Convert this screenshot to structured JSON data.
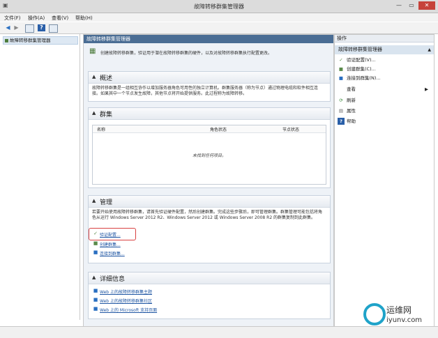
{
  "window": {
    "title": "故障转移群集管理器",
    "btn_min": "—",
    "btn_max": "▭",
    "btn_close": "✕"
  },
  "menu": [
    "文件(F)",
    "操作(A)",
    "查看(V)",
    "帮助(H)"
  ],
  "toolbar": {
    "back": "◀",
    "forward": "▶"
  },
  "tree": {
    "root": "故障转移群集管理器"
  },
  "center": {
    "header": "故障转移群集管理器",
    "intro": "创建故障转移群集，验证用于潜在故障转移群集的硬件，以及对故障转移群集执行配置更改。",
    "overview": {
      "title": "概述",
      "text": "故障转移群集是一组相互协作以增加服务器角色可用性的独立计算机。群集服务器（称为节点）通过物理电缆和软件相互连接。如果其中一个节点发生故障，其他节点将开始提供服务。此过程称为故障转移。"
    },
    "clusters": {
      "title": "群集",
      "columns": [
        "名称",
        "角色状态",
        "节点状态"
      ],
      "empty": "未找到任何项目。"
    },
    "manage": {
      "title": "管理",
      "text": "若要开始使用故障转移群集，请首先验证硬件配置，然后创建群集。完成这些步骤后，即可管理群集。群集管理可能包括将角色从运行 Windows Server 2012 R2、Windows Server 2012 或 Windows Server 2008 R2 的群集复制到此群集。",
      "links": [
        "验证配置...",
        "创建群集...",
        "连接到群集..."
      ]
    },
    "info": {
      "title": "详细信息",
      "links": [
        "Web 上的故障转移群集主题",
        "Web 上的故障转移群集社区",
        "Web 上的 Microsoft 支持页面"
      ]
    }
  },
  "actions": {
    "header": "操作",
    "group": "故障转移群集管理器",
    "items": [
      "验证配置(V)...",
      "创建群集(C)...",
      "连接到群集(N)...",
      "查看",
      "刷新",
      "属性",
      "帮助"
    ]
  },
  "watermark": {
    "brand": "运维网",
    "domain": "iyunv.com"
  }
}
